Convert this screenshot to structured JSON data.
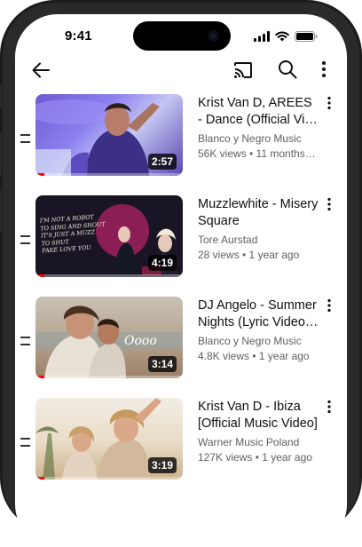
{
  "status_bar": {
    "time": "9:41"
  },
  "app_bar": {
    "back_icon": "back-arrow-icon",
    "cast_icon": "cast-icon",
    "search_icon": "search-icon",
    "more_icon": "more-vert-icon"
  },
  "videos": [
    {
      "title_line1": "Krist Van D, AREES",
      "title_line2": "- Dance (Official Vi…",
      "channel": "Blanco y Negro Music",
      "meta": "56K views • 11 months…",
      "duration": "2:57",
      "watched_fraction": 0.06
    },
    {
      "title_line1": "Muzzlewhite - Misery",
      "title_line2": "Square",
      "channel": "Tore Aurstad",
      "meta": "28 views • 1 year ago",
      "duration": "4:19",
      "watched_fraction": 0.06
    },
    {
      "title_line1": "DJ Angelo - Summer",
      "title_line2": "Nights (Lyric Video…",
      "channel": "Blanco y Negro Music",
      "meta": "4.8K views • 1 year ago",
      "duration": "3:14",
      "watched_fraction": 0.06
    },
    {
      "title_line1": "Krist Van D - Ibiza",
      "title_line2": "[Official Music Video]",
      "channel": "Warner Music Poland",
      "meta": "127K views • 1 year ago",
      "duration": "3:19",
      "watched_fraction": 0.06
    }
  ],
  "thumbnail_texts": {
    "video2_lyrics": [
      "I'M NOT A ROBOT",
      "TO SING AND SHOUT",
      "IT'S JUST A MUZZ",
      "TO SHUT",
      "FAKE LOVE YOU"
    ],
    "video3_overlay": "Oooo"
  },
  "colors": {
    "progress_red": "#ff0000",
    "text_primary": "#0f0f0f",
    "text_secondary": "#606060"
  }
}
